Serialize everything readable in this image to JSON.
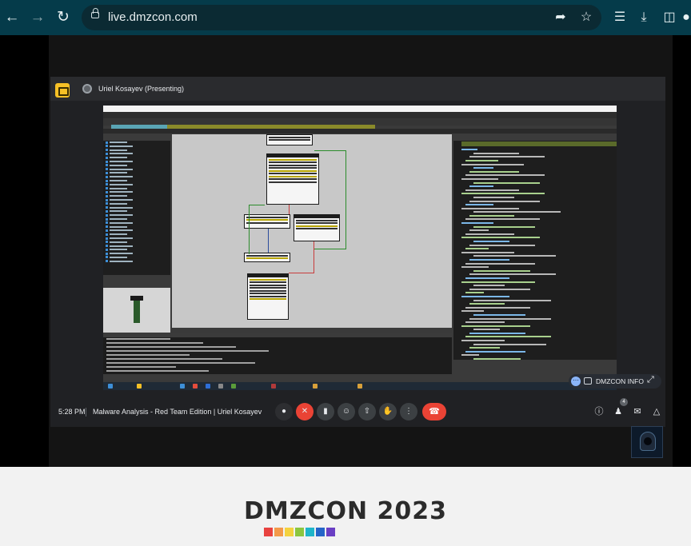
{
  "browser": {
    "url": "live.dmzcon.com",
    "back_icon": "arrow-left-icon",
    "forward_icon": "arrow-right-icon",
    "reload_icon": "reload-icon"
  },
  "meet": {
    "presenter_name": "Uriel Kosayev (Presenting)",
    "time": "5:28 PM",
    "meeting_title": "Malware Analysis - Red Team Edition | Uriel Kosayev",
    "participant_count": "4",
    "caption_label": "DMZCON INFO"
  },
  "footer": {
    "logo": "DMZCON 2023",
    "swatch_colors": [
      "#e8423f",
      "#f39a4a",
      "#f4d23f",
      "#8cc63f",
      "#1fb5c9",
      "#2565c8",
      "#6a3fc4"
    ]
  },
  "accent_colors": {
    "end_call": "#ea4335",
    "chrome": "#053b4a"
  }
}
